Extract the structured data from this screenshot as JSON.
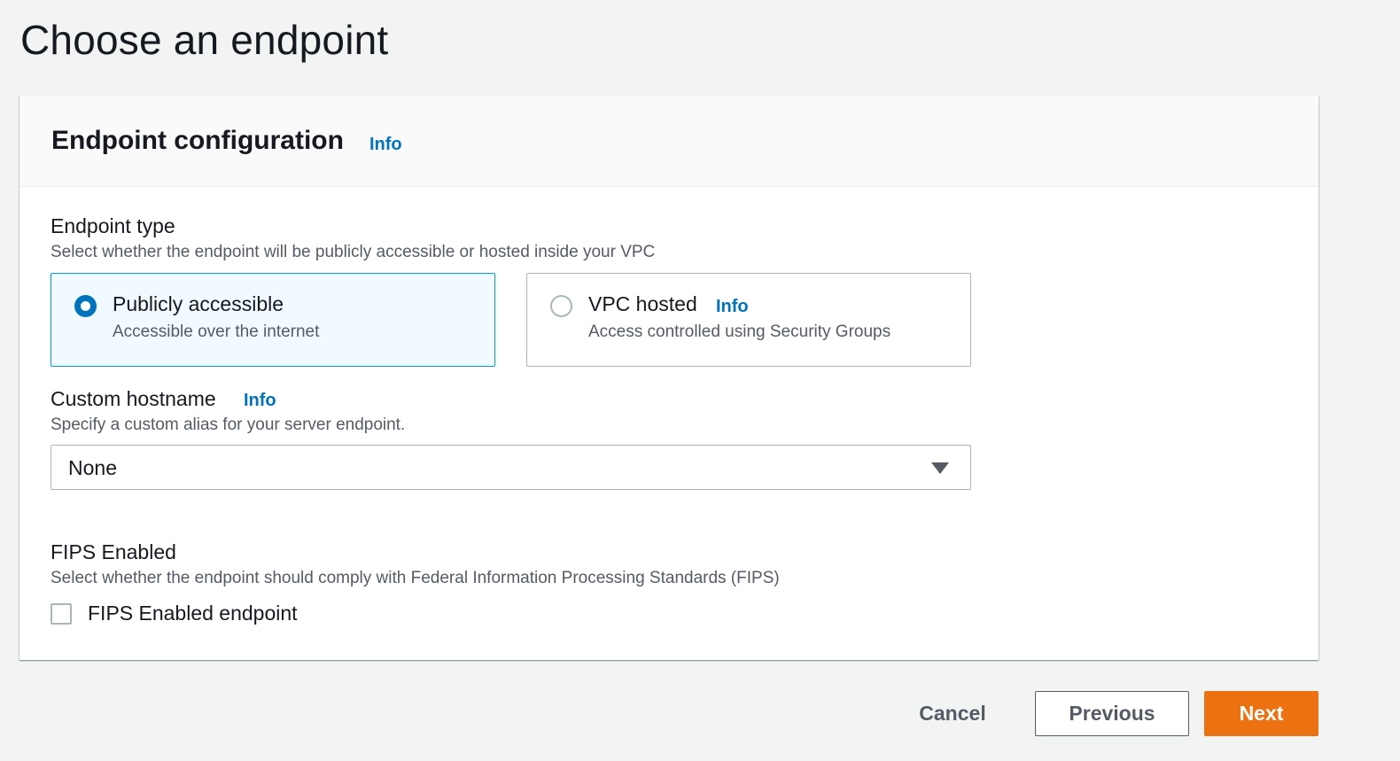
{
  "page": {
    "title": "Choose an endpoint"
  },
  "panel": {
    "title": "Endpoint configuration",
    "info": "Info"
  },
  "endpoint_type": {
    "label": "Endpoint type",
    "description": "Select whether the endpoint will be publicly accessible or hosted inside your VPC",
    "options": [
      {
        "label": "Publicly accessible",
        "description": "Accessible over the internet",
        "selected": true
      },
      {
        "label": "VPC hosted",
        "description": "Access controlled using Security Groups",
        "info": "Info",
        "selected": false
      }
    ]
  },
  "custom_hostname": {
    "label": "Custom hostname",
    "info": "Info",
    "description": "Specify a custom alias for your server endpoint.",
    "value": "None"
  },
  "fips": {
    "label": "FIPS Enabled",
    "description": "Select whether the endpoint should comply with Federal Information Processing Standards (FIPS)",
    "checkbox_label": "FIPS Enabled endpoint",
    "checked": false
  },
  "actions": {
    "cancel": "Cancel",
    "previous": "Previous",
    "next": "Next"
  },
  "colors": {
    "accent": "#0073bb",
    "primary_button": "#ec7211",
    "selected_tile_bg": "#f1faff",
    "selected_tile_border": "#00a1c9"
  },
  "icons": {
    "dropdown": "caret-down-icon"
  }
}
